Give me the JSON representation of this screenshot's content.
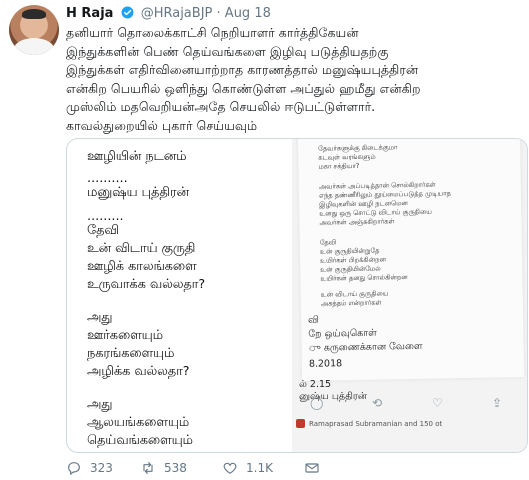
{
  "tweet": {
    "author_name": "H Raja",
    "handle": "@HRajaBJP",
    "separator": "·",
    "date": "Aug 18",
    "lines": [
      "தனியார் தொலைக்காட்சி நெறியாளர் கார்த்திகேயன்",
      "இந்துக்களின் பெண் தெய்வங்களை இழிவு படுத்தியதற்கு",
      "இந்துக்கள் எதிர்வினையாற்றாத காரணத்தால் மனுஷ்யபுத்திரன்",
      "என்கிற பெயரில் ஒளிந்து கொண்டுள்ள அப்துல் ஹமீது என்கிற",
      "முஸ்லிம் மதவெறியன்அதே செயலில் ஈடுபட்டுள்ளார்.",
      "காவல்துறையில் புகார் செய்யவும்"
    ]
  },
  "media": {
    "poem_lines": [
      "ஊழியின் நடனம்",
      "..........",
      "மனுஷ்ய புத்திரன்",
      ".........",
      "தேவி",
      "உன் விடாய் குருதி",
      "ஊழிக் காலங்களை",
      "உருவாக்க வல்லதா?",
      "அது",
      "ஊர்களையும்",
      "நகரங்களையும்",
      "அழிக்க வல்லதா?",
      "அது",
      "ஆலயங்களையும்",
      "தெய்வங்களையும்"
    ],
    "photo_small_lines": [
      "தேவர்களுக்கு கிடைக்குமா",
      "கடவுள் வரங்களும்",
      "மகா சக்தியா?",
      "அவர்கள் அப்படித்தான் சொல்கிறார்கள்",
      "எந்த தண்ணீரிலும் தூய்மைப்படுத்த முடியாத",
      "இழிவுகளின் ஊழி நடனமென",
      "உனது ஒரு சொட்டு விடாய் குருதியை",
      "அவர்கள் அஞ்சுகிறார்கள்",
      "தேவி",
      "உன் குருதியின்றுதே",
      "உயிர்கள் பிறக்கின்றன",
      "உன் குருதியின்மேல்",
      "உயிர்கள் தனது சொல்கின்றன",
      "உன் விடாய் குருதியை",
      "அசுத்தம் என்றார்கள்"
    ],
    "photo_big_lines": [
      "வி",
      "றே ஒய்வுகொள்",
      "ு கருணைக்கான வேளை",
      "8.2018",
      "ல் 2.15",
      "னுஷ்ய புத்திரன்"
    ],
    "retweet_label": "Ramaprasad Subramanian and 150 ot"
  },
  "actions": {
    "replies": "323",
    "retweets": "538",
    "likes": "1.1K"
  },
  "colors": {
    "text": "#14171a",
    "muted": "#657786",
    "verified": "#1da1f2",
    "border": "#cfd9de"
  }
}
